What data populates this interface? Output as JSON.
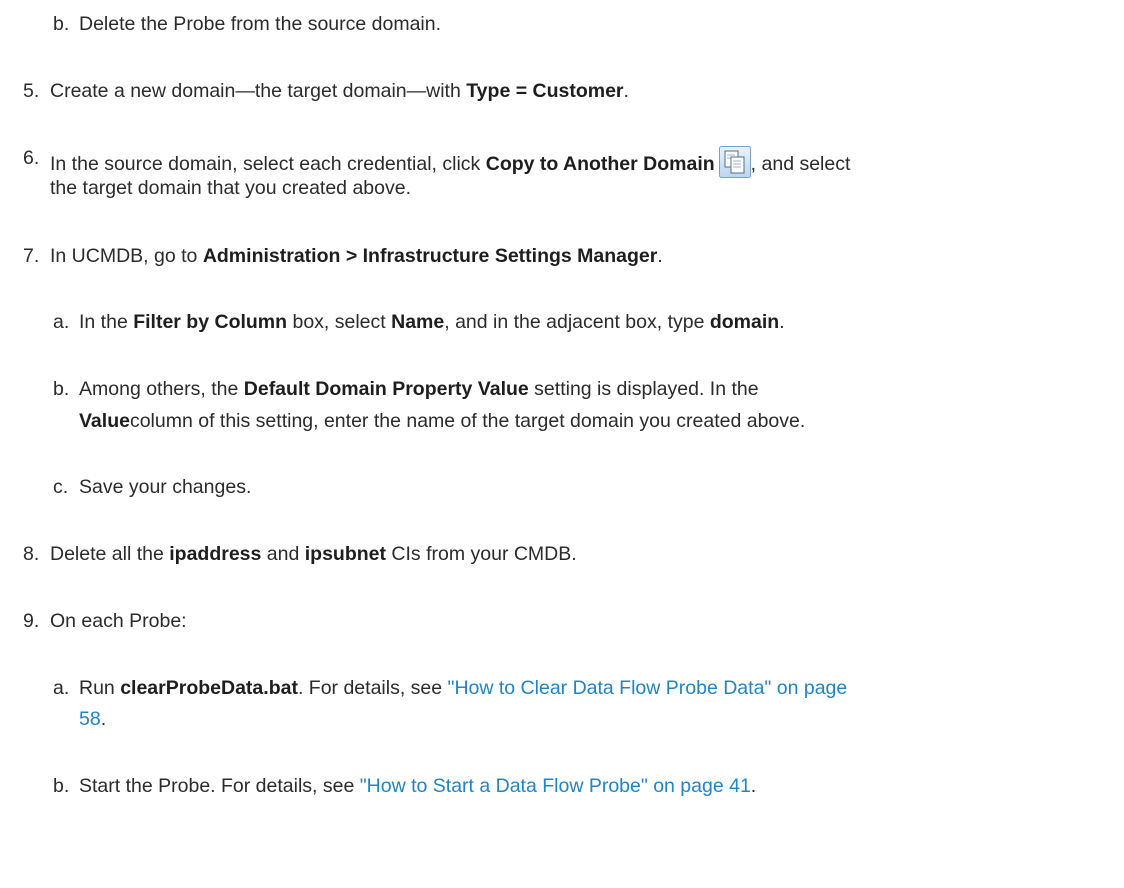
{
  "steps": {
    "s4b": {
      "marker": "b.",
      "t1": "Delete the Probe from the source domain."
    },
    "s5": {
      "marker": "5.",
      "t1": "Create a new domain—the target domain—with ",
      "b1": "Type = Customer",
      "t2": "."
    },
    "s6": {
      "marker": "6.",
      "t1": "In the source domain, select each credential, click ",
      "b1": "Copy to Another Domain",
      "t2": ", and select",
      "line2": "the target domain that you created above."
    },
    "s7": {
      "marker": "7.",
      "t1": "In UCMDB, go to ",
      "b1": "Administration > Infrastructure Settings Manager",
      "t2": "."
    },
    "s7a": {
      "marker": "a.",
      "t1": "In the ",
      "b1": "Filter by Column",
      "t2": " box, select ",
      "b2": "Name",
      "t3": ", and in the adjacent box, type ",
      "b3": "domain",
      "t4": "."
    },
    "s7b": {
      "marker": "b.",
      "t1": "Among others, the ",
      "b1": "Default Domain Property Value",
      "t2": " setting is displayed. In the",
      "b2": "Value",
      "t3": "column of this setting, enter the name of the target domain you created above."
    },
    "s7c": {
      "marker": "c.",
      "t1": "Save your changes."
    },
    "s8": {
      "marker": "8.",
      "t1": "Delete all the ",
      "b1": "ipaddress",
      "t2": " and ",
      "b2": "ipsubnet",
      "t3": " CIs from your CMDB."
    },
    "s9": {
      "marker": "9.",
      "t1": "On each Probe:"
    },
    "s9a": {
      "marker": "a.",
      "t1": "Run ",
      "b1": "clearProbeData.bat",
      "t2": ". For details, see ",
      "link1": "\"How to Clear Data Flow Probe Data\" on page",
      "link2": "58",
      "t3": "."
    },
    "s9b": {
      "marker": "b.",
      "t1": "Start the Probe. For details, see ",
      "link1": "\"How to Start a Data Flow Probe\" on page 41",
      "t2": "."
    }
  },
  "icons": {
    "copy": "copy-to-domain-icon"
  },
  "colors": {
    "text": "#2b2b2b",
    "link": "#1f84c8"
  }
}
